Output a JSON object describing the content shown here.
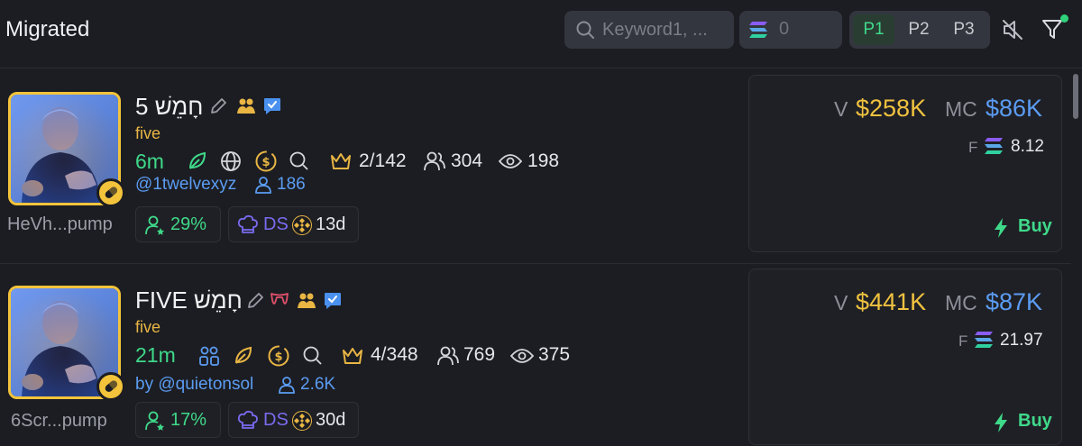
{
  "header": {
    "title": "Migrated",
    "search_placeholder": "Keyword1, ...",
    "sol_value": "0",
    "pages": [
      "P1",
      "P2",
      "P3"
    ],
    "active_page": "P1"
  },
  "tokens": [
    {
      "name": "5 חָמֵשׁ",
      "ticker": "five",
      "age": "6m",
      "top10": "2/142",
      "holders_count": "304",
      "views": "198",
      "creator": "@1twelvexyz",
      "creator_followers": "186",
      "address": "HeVh...pump",
      "snipers_pct": "29%",
      "dev_tag": "DS",
      "dev_age": "13d",
      "volume_label": "V",
      "volume": "$258K",
      "mc_label": "MC",
      "market_cap": "$86K",
      "fee_label": "F",
      "fees": "8.12",
      "buy_label": "Buy"
    },
    {
      "name": "FIVE חָמֵשׁ",
      "ticker": "five",
      "age": "21m",
      "top10": "4/348",
      "holders_count": "769",
      "views": "375",
      "creator": "by @quietonsol",
      "creator_followers": "2.6K",
      "address": "6Scr...pump",
      "snipers_pct": "17%",
      "dev_tag": "DS",
      "dev_age": "30d",
      "volume_label": "V",
      "volume": "$441K",
      "mc_label": "MC",
      "market_cap": "$87K",
      "fee_label": "F",
      "fees": "21.97",
      "buy_label": "Buy"
    }
  ],
  "colors": {
    "background": "#1c1d22",
    "accent_green": "#3fd98a",
    "accent_blue": "#5b9cf2",
    "accent_gold": "#f0c240"
  },
  "icons": [
    "search-icon",
    "solana-icon",
    "mute-icon",
    "filter-icon",
    "edit-icon",
    "people-icon",
    "verified-icon",
    "leaf-icon",
    "globe-icon",
    "coin-icon",
    "crown-icon",
    "users-icon",
    "eye-icon",
    "user-icon",
    "chef-hat-icon",
    "bnb-icon",
    "lightning-icon",
    "pill-icon",
    "fangs-icon"
  ]
}
